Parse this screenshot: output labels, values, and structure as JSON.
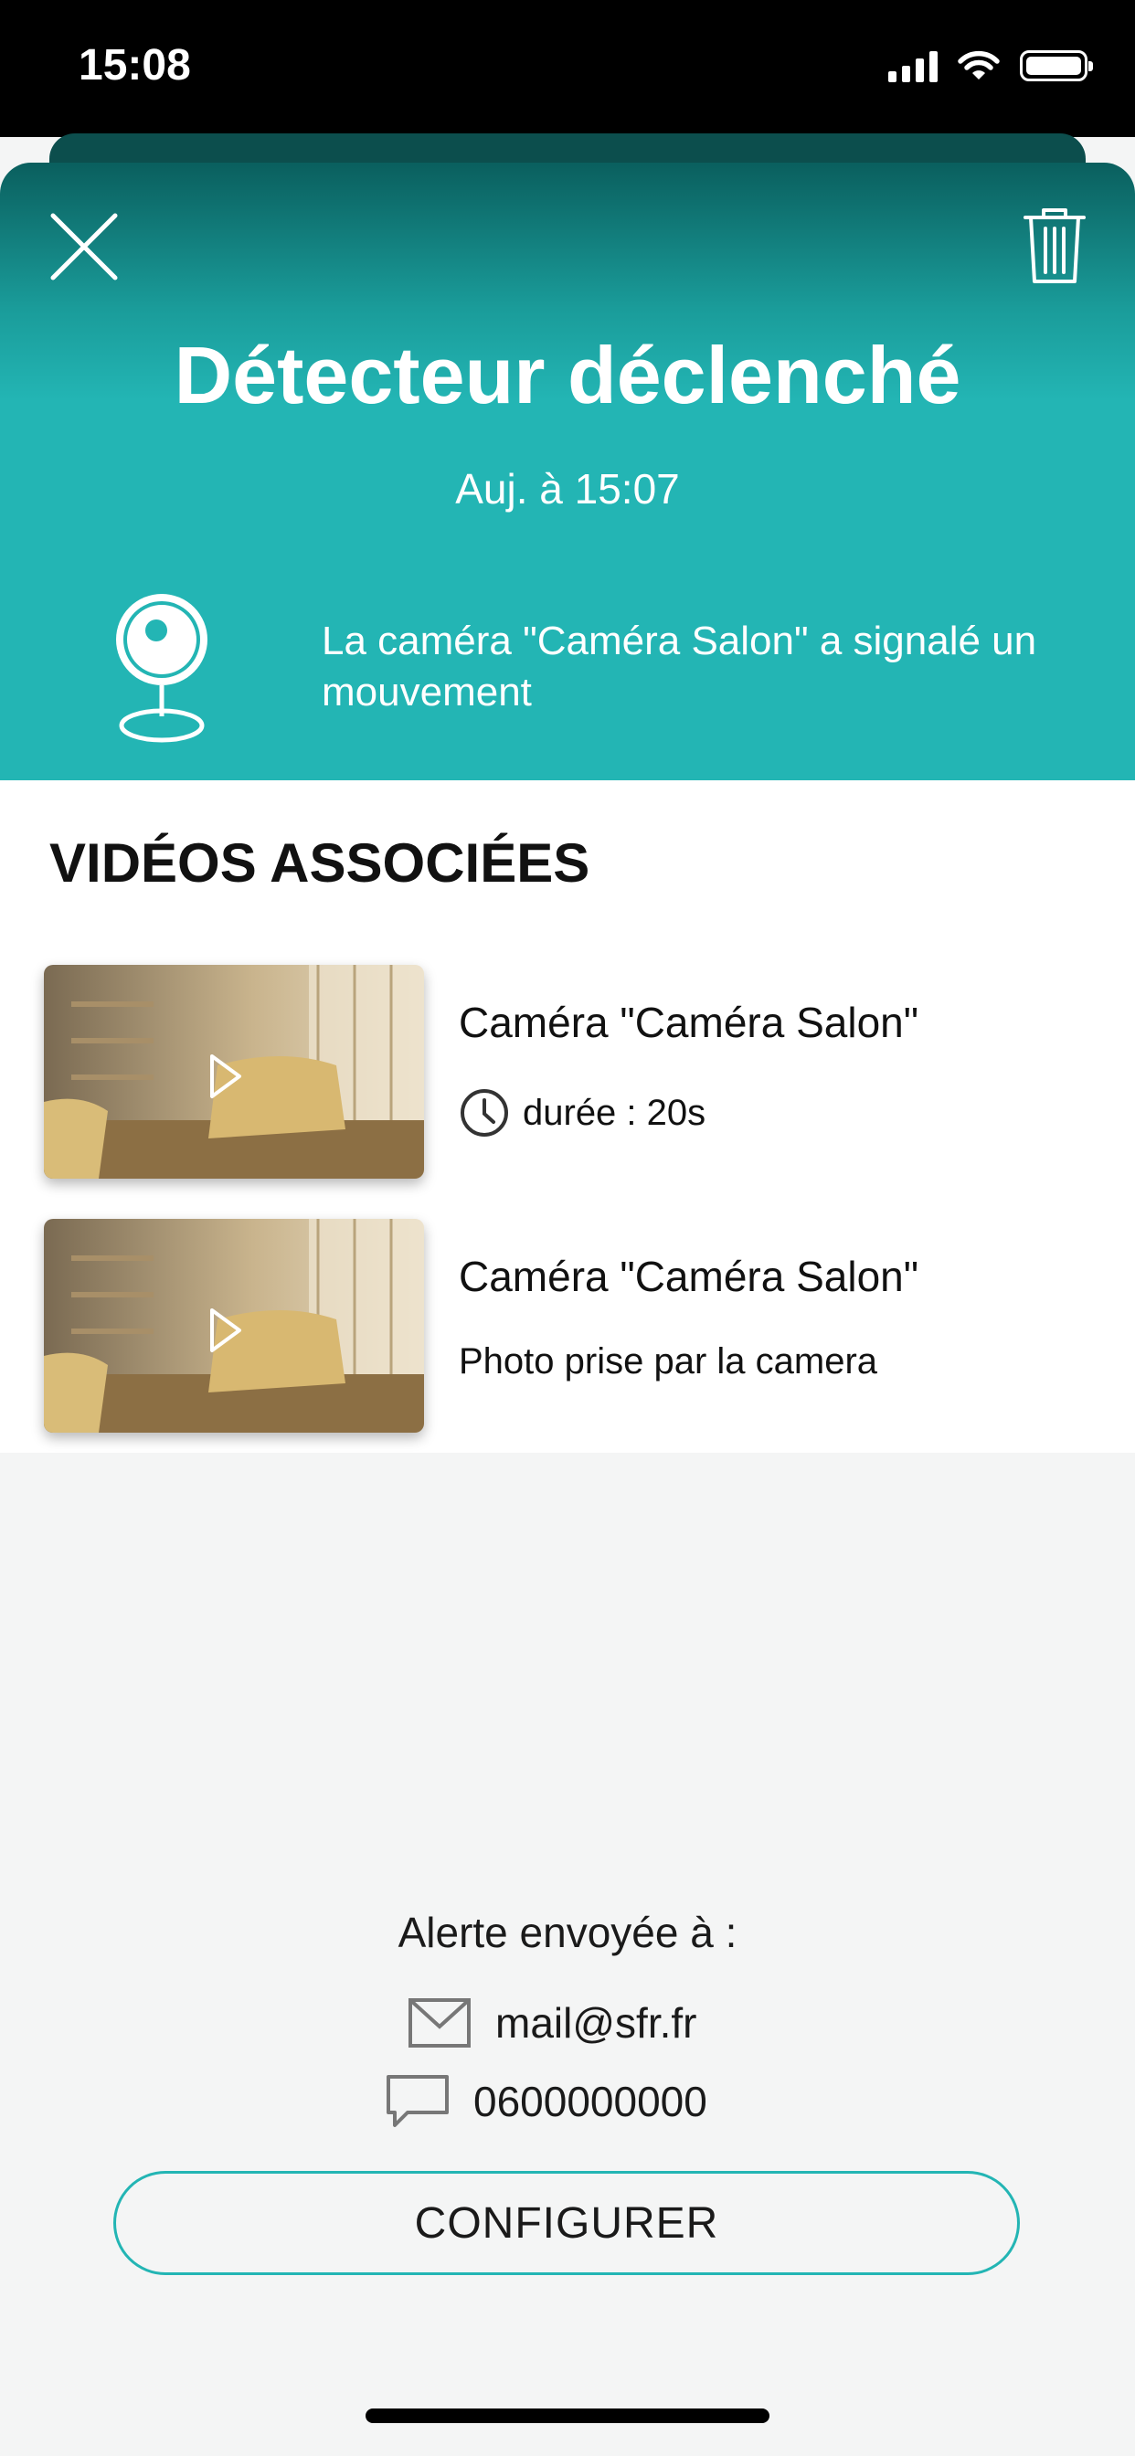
{
  "status_bar": {
    "time": "15:08"
  },
  "header": {
    "title": "Détecteur déclenché",
    "date": "Auj. à 15:07",
    "message": "La caméra \"Caméra Salon\" a signalé un mouvement",
    "colors": {
      "accent": "#23b5b4",
      "dark": "#0a5f5e"
    }
  },
  "videos": {
    "section_title": "VIDÉOS ASSOCIÉES",
    "items": [
      {
        "title": "Caméra \"Caméra Salon\"",
        "subtitle": "durée : 20s",
        "icon": "clock-icon"
      },
      {
        "title": "Caméra \"Caméra Salon\"",
        "subtitle": "Photo prise par la camera"
      }
    ]
  },
  "alerts": {
    "label": "Alerte envoyée à :",
    "email": "mail@sfr.fr",
    "phone": "0600000000",
    "configure_label": "CONFIGURER"
  }
}
